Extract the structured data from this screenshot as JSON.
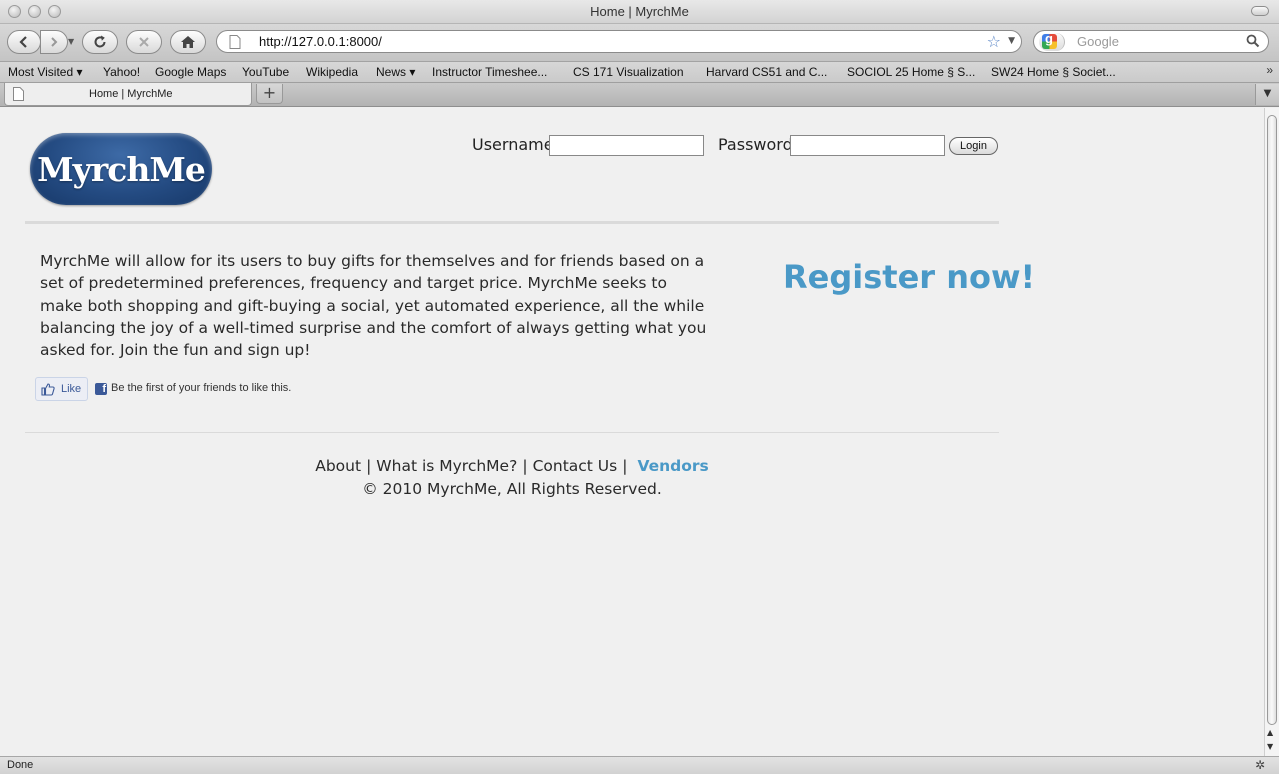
{
  "window": {
    "title": "Home | MyrchMe"
  },
  "navbar": {
    "url": "http://127.0.0.1:8000/",
    "search_placeholder": "Google"
  },
  "bookmarks": [
    {
      "label": "Most Visited ▾"
    },
    {
      "label": "Yahoo!"
    },
    {
      "label": "Google Maps"
    },
    {
      "label": "YouTube"
    },
    {
      "label": "Wikipedia"
    },
    {
      "label": "News ▾"
    },
    {
      "label": "Instructor Timeshee..."
    },
    {
      "label": "CS 171 Visualization"
    },
    {
      "label": "Harvard CS51 and C..."
    },
    {
      "label": "SOCIOL 25 Home § S..."
    },
    {
      "label": "SW24 Home § Societ..."
    }
  ],
  "tab": {
    "title": "Home | MyrchMe",
    "new_tab": "+"
  },
  "page": {
    "logo": "MyrchMe",
    "login": {
      "username_label": "Username:",
      "password_label": "Password:",
      "button": "Login"
    },
    "intro": "MyrchMe will allow for its users to buy gifts for themselves and for friends based on a set of predetermined preferences, frequency and target price. MyrchMe seeks to make both shopping and gift-buying a social, yet automated experience, all the while balancing the joy of a well-timed surprise and the comfort of always getting what you asked for. Join the fun and sign up!",
    "register": "Register now!",
    "facebook": {
      "like": "Like",
      "text": "Be the first of your friends to like this."
    },
    "footer": {
      "about": "About",
      "what": "What is MyrchMe?",
      "contact": "Contact Us",
      "vendors": "Vendors",
      "separator": "|",
      "copyright": "© 2010 MyrchMe, All Rights Reserved."
    }
  },
  "status": {
    "text": "Done"
  },
  "colors": {
    "accent": "#4a99c7",
    "logo": "#244b82",
    "facebook": "#3b5998"
  }
}
